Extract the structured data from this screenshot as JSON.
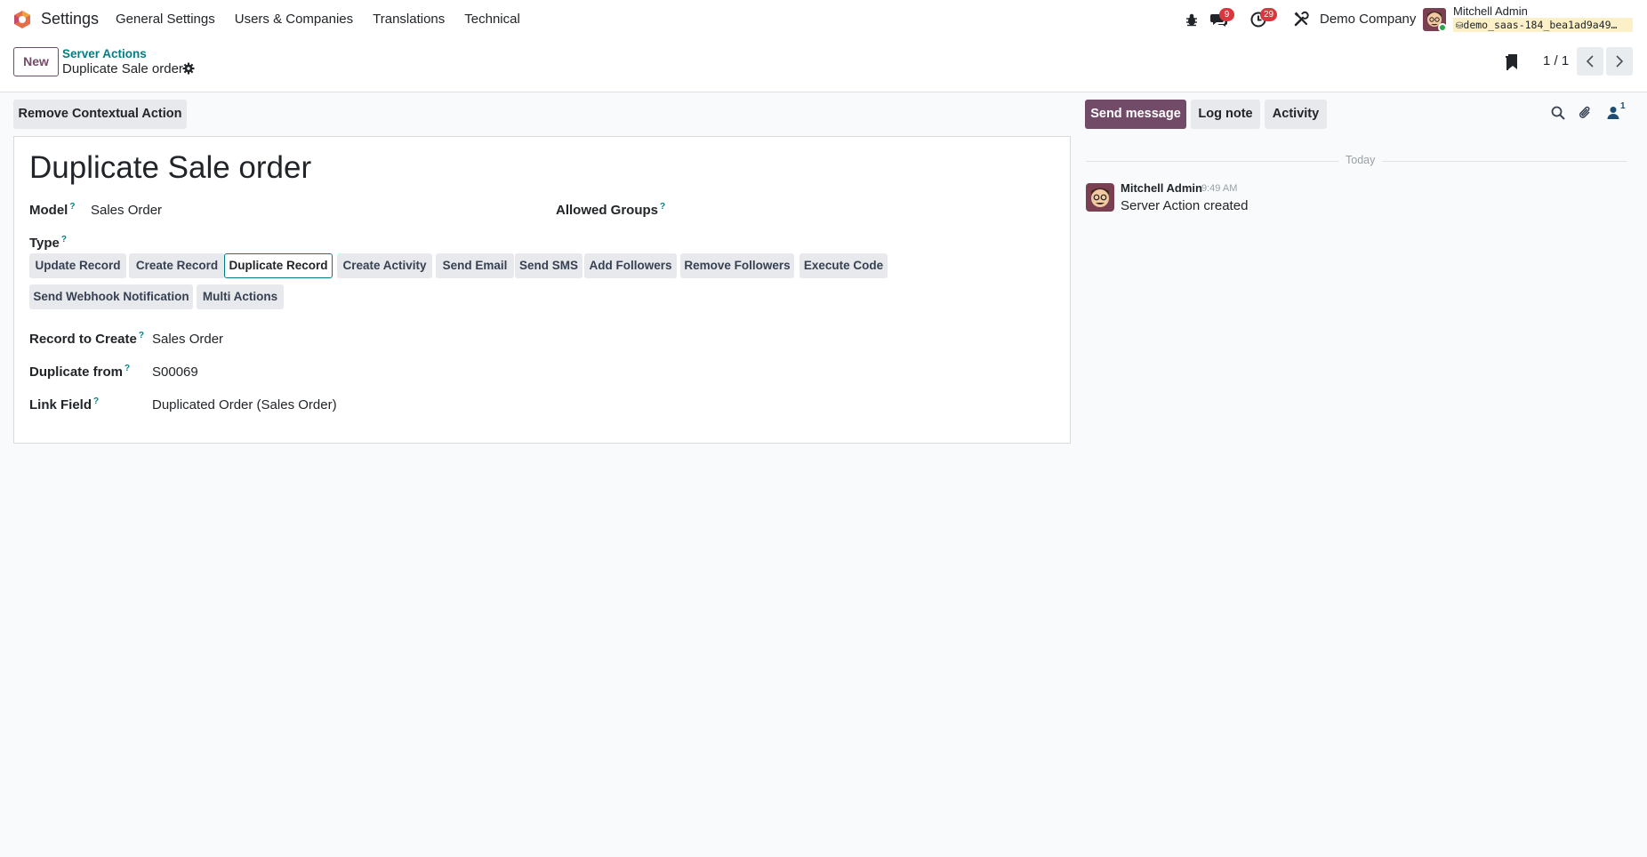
{
  "navbar": {
    "app_name": "Settings",
    "menu": [
      "General Settings",
      "Users & Companies",
      "Translations",
      "Technical"
    ],
    "messages_count": "9",
    "activities_count": "29",
    "company": "Demo Company",
    "user_name": "Mitchell Admin",
    "database": "demo_saas-184_bea1ad9a49…"
  },
  "control_panel": {
    "new_label": "New",
    "breadcrumb_parent": "Server Actions",
    "breadcrumb_current": "Duplicate Sale order",
    "pager": "1 / 1"
  },
  "form": {
    "remove_action_label": "Remove Contextual Action",
    "title": "Duplicate Sale order",
    "model_label": "Model",
    "model_value": "Sales Order",
    "allowed_groups_label": "Allowed Groups",
    "type_label": "Type",
    "types": [
      "Update Record",
      "Create Record",
      "Duplicate Record",
      "Create Activity",
      "Send Email",
      "Send SMS",
      "Add Followers",
      "Remove Followers",
      "Execute Code",
      "Send Webhook Notification",
      "Multi Actions"
    ],
    "active_type": "Duplicate Record",
    "record_to_create_label": "Record to Create",
    "record_to_create_value": "Sales Order",
    "duplicate_from_label": "Duplicate from",
    "duplicate_from_value": "S00069",
    "link_field_label": "Link Field",
    "link_field_value": "Duplicated Order (Sales Order)"
  },
  "chatter": {
    "send_message_label": "Send message",
    "log_note_label": "Log note",
    "activity_label": "Activity",
    "followers_count": "1",
    "date_separator": "Today",
    "message": {
      "author": "Mitchell Admin",
      "time": "9:49 AM",
      "body": "Server Action created"
    }
  },
  "colors": {
    "primary": "#714b67",
    "accent": "#017e84",
    "badge": "#d9363e"
  }
}
